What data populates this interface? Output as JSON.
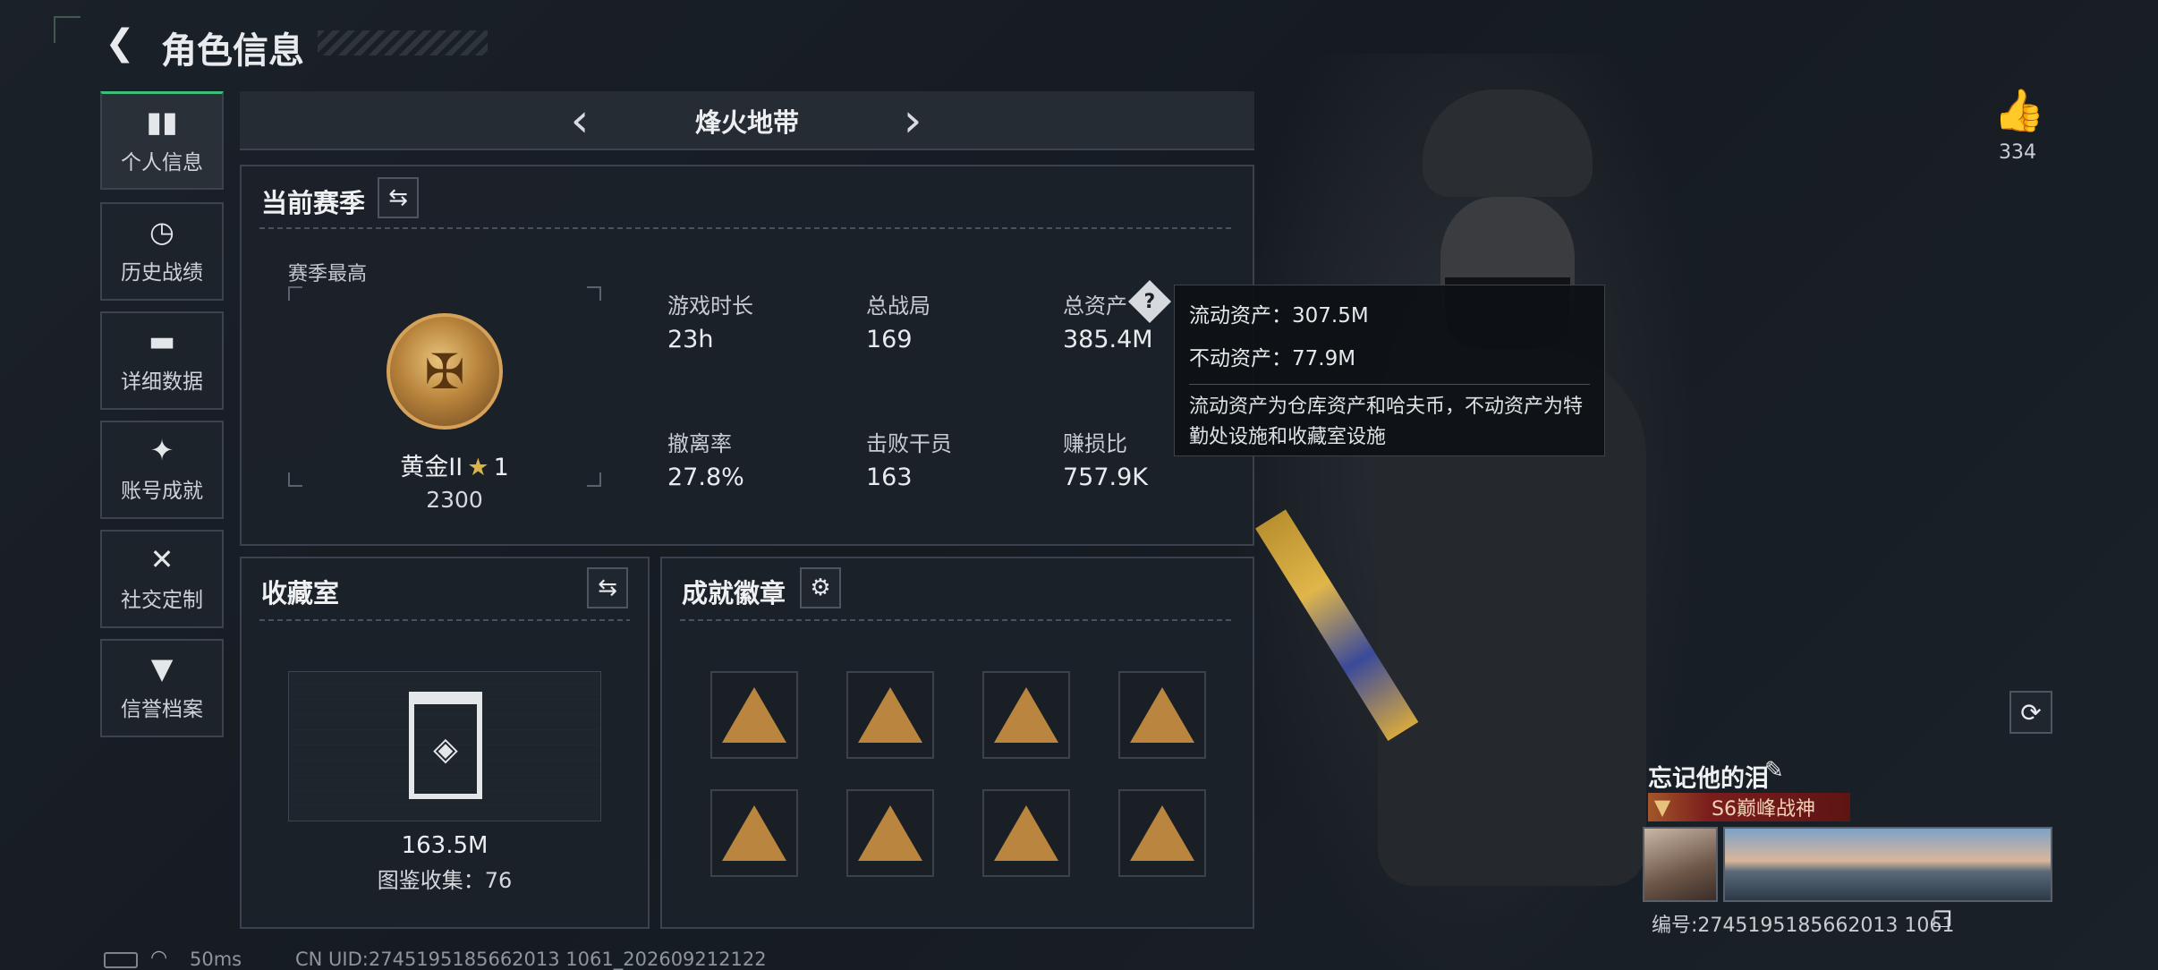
{
  "header": {
    "title": "角色信息",
    "back_icon": "back-arrow-icon"
  },
  "sidebar": {
    "items": [
      {
        "label": "个人信息",
        "icon": "bar-chart-icon",
        "active": true
      },
      {
        "label": "历史战绩",
        "icon": "clock-icon"
      },
      {
        "label": "详细数据",
        "icon": "folder-icon"
      },
      {
        "label": "账号成就",
        "icon": "star-badge-icon"
      },
      {
        "label": "社交定制",
        "icon": "tools-icon"
      },
      {
        "label": "信誉档案",
        "icon": "shield-icon"
      }
    ]
  },
  "mode_selector": {
    "label": "烽火地带"
  },
  "season": {
    "title": "当前赛季",
    "best_label": "赛季最高",
    "rank_name": "黄金II",
    "rank_stars": "1",
    "rank_score": "2300",
    "stats": [
      {
        "label": "游戏时长",
        "value": "23h"
      },
      {
        "label": "总战局",
        "value": "169"
      },
      {
        "label": "总资产",
        "value": "385.4M"
      },
      {
        "label": "撤离率",
        "value": "27.8%"
      },
      {
        "label": "击败干员",
        "value": "163"
      },
      {
        "label": "赚损比",
        "value": "757.9K"
      }
    ]
  },
  "tooltip": {
    "liquid": "流动资产：307.5M",
    "fixed": "不动资产：77.9M",
    "desc": "流动资产为仓库资产和哈夫币，不动资产为特勤处设施和收藏室设施"
  },
  "collection": {
    "title": "收藏室",
    "value": "163.5M",
    "catalog": "图鉴收集：76"
  },
  "achievements": {
    "title": "成就徽章",
    "badge_count": 8
  },
  "player": {
    "likes": "334",
    "name": "忘记他的泪",
    "title_badge": "S6巅峰战神",
    "id": "编号:2745195185662013 1061",
    "id_display": "编号:2745195185662013 1061"
  },
  "status": {
    "ping": "50ms",
    "uid": "CN UID:2745195185662013 1061_202609212122"
  },
  "colors": {
    "accent_green": "#3bbf7a",
    "gold": "#c79a4a",
    "title_red": "#7b1d1d"
  }
}
